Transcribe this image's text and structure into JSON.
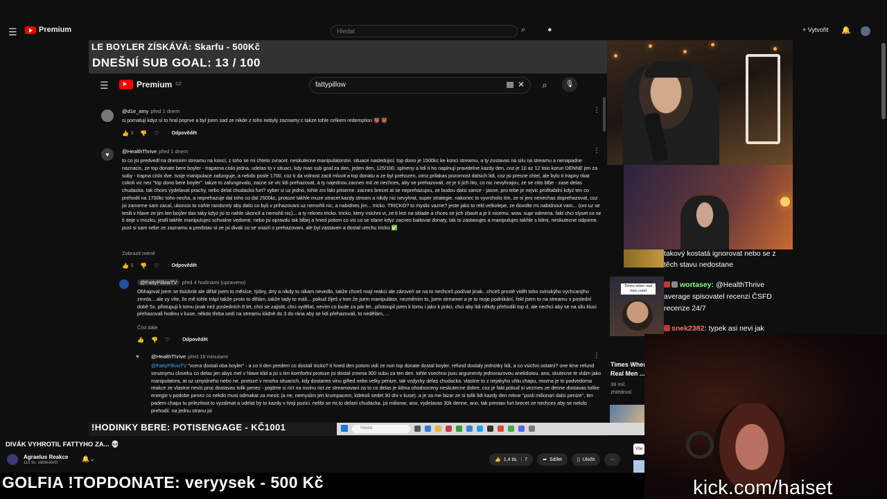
{
  "outer": {
    "menu_icon": "☰",
    "logo_text": "Premium",
    "search_placeholder": "Hledat",
    "create_label": "+ Vytvořit"
  },
  "overlay": {
    "line1": "LE BOYLER ZÍSKÁVÁ: Skarfu - 500Kč",
    "line2": "DNEŠNÍ SUB GOAL: 13 / 100",
    "bottom": "!HODINKY BERE: POTISENGAGE - KČ1001"
  },
  "inner": {
    "logo_text": "Premium",
    "logo_sup": "CZ",
    "search_value": "fattypillow"
  },
  "comments": [
    {
      "author": "@d1e_amy",
      "when": "před 1 dnem",
      "text": "si pomatuji kdyz si to hral poprve a byl jsem sad ze nikde z toho nebyly zaznamy:c takze tohle celkem redemption 👹 👹",
      "likes": "3",
      "reply": "Odpovědět"
    },
    {
      "author": "@HealthThrive",
      "when": "před 1 dnem",
      "text": "to co jsi predvedl na dnesnim streamu na konci, z toho se mi chtelo zvracet. neskutecne manipulatorstvi. situace nasledujici: top dono je 1500kc ke konci streamu, a ty zustavas na silu na streamu a nenapadne naznacis, ze top donate bere boyler - traparna cislo jedna. udelas to v situaci, kdy mas sub goal za den, jeden den, 125/100, splneny a lidi ti ho naplnuji pravidelne kazdy den, coz je 10 az 12 tisic korun DENNE jen za suby - trapna cislo dve. tvoje manipulace zafunguje, a nekdo posle 1700, coz ti da volnost zacit mluvit a top donatu a ze byl prehozen, cimz prilakas pozornost dalsich lidi, coz jsi presne chtel, ale bylo ti trapny rikat cokoli vic nez \"top dono bere boyler\". takze to zafungovalo, zacne se vic lidi prehazovat, a ty najednou zacnes mit ze nechces, aby se prehazovali, ze je ti jich lito, co nic nevyhrajou, ze se citis blbe - zase delas chudacka. tak chces vydelavat prachy, nebo delat chudacka furt? vyber si uz jedno, tohle zni fakt priserne. zacnes brecet at se neprehazujou, ze budou dalsi sance - jasne, pro tebe je nejvic profitabilni kdyz ten co prehodil na 1700kc toho necha, a neprehazuje dal toho co dal 2500kc, protoze takhle muze utracet kazdy stream a nikdy nic nevyhrat, super strategie. nakonec to vyvrcholis tim, ze si jeni nenechas doprehazovat, coz jsi zamerne sam zacal, ukoncis to nahle randomly aby dalsi co byli v prihazovani uz nemohli nic, a nabidnes jim... tricko. TRICKO? to myslis vazne? jeste jaks to rekl velkolepe, ze dovolte mi nabidnout vam... (oni uz se tesili v hlave ze jim ten boyler das taky kdyz jsi to nahle ukoncil a nemohli nic)... a ty reknes tricko. tricko, ktery vsichni vi, ze ti lezi na sklade a chces se jich zbavit a je k nicemu. wow. supr odmena. fakt chci slyset co se ti deje v mozku, jestli takhle manipulujes schvalne vedome, nebo jsi opravdu tak blbej a hned potom co vis co se stane kdyz zacnes baitovat donaty, tak to zastavujes a manipulujes takhle s lidmi, neskutecne odporne. pust si sam sebe ze zaznamu a predstav si ze jsi divak co se snazil o prehazovani, ale byl zastaven a dostal utechu tricko ✅",
      "more": "Zobrazit méně",
      "likes": "5",
      "reply": "Odpovědět"
    },
    {
      "author": "@FattyPillowTV",
      "when": "před 4 hodinami (upraveno)",
      "text": "Obhajoval jsem se tisíckrát ale dělal jsem to měsíce, týdny, dny a nikdy to nikam nevedlo, takže chceš moji reakci ale zároveň se na to nechceš podívat jinak...chceš prostě vidět toho svinskýho vychcanýho zmrda....ale vy víte, že mě tohle trápí takže proto to dělám..takže tady to máš... pokud žiješ v tom že jsem manipulátor, nezměním to, jsem streamer a je to moje podnikání, řekl jsem to na streamu v poslední době 5x, přistupuji k tomu jinak než posledních 8 let, chci se zajistit, chci vydělat, nevím co bude za pár let...přistoupil jsem k tomu i jako k práci, chci aby lidi někdy přehodili top d, ale nechci aby se na silu kluci přehazovali hodinu v kuse, někdo třeba sedí na streamu klidně do 3 do rána aby se lidi přehazovali, to nedělám, ...",
      "more": "Číst dále",
      "reply": "Odpovědět"
    },
    {
      "author": "@HealthThrive",
      "when": "před 19 minutami",
      "mention": "@FattyPillowTV",
      "text": "\"vcera dostali oba boyler\" - a co ti den predem co dostali tricko? ti hned den potom vidi ze non top donate dostal boyler. refund dostaly jednotky lidi, a co vsichni ostatni? one time refund smutnymu cloveku co delas jen abys mel v hlave klid a jsi s tim komfortni protoze jsi dostal zrovna 300 subu za ten den. tohle vsechno jsou argumenty jednorazovou anekdotou. ano, skutecne te vidim jako manipulatora, at uz umyslneho nebo ne. protoze v mnoha situacich, kdy dostanes vinu gifted nebo velky penize, tak vzdycky delas chudacka. vlastne to z nejakyho uhlu chapu, mozna je to podvedoma reakce ze vlastne nevis proc dostavas tolik penez - pojdme si rict na rovinu rict ze streamovani za to co delas je lidma ohodnoceny neskutecne dobre, coz je fakt pokud si vezmes ze denne dostavas tolike energie v podobe penez co nekdo musi odmakat za mesic (a ne, nemyslim jen krumpacem, kdekoli sedet 30 dni v kuse). a je za me bizar ze si tolik lidi kazdy den rekne \"posli milionari dalsi penize\", tim padem chapu tu prilezitost to vyzdimat a udelat by to kazdy v tvoji pozici. nelibi se mi to delani chudacka. jsi milionar, ano, vydelavas 30k denne, ano, tak prestan furt brecet ze nechces aby se nekdo prehodil. na jednu stranu jsi"
    }
  ],
  "side": {
    "chat": [
      {
        "user": "",
        "text": "takový kostatá ignorovat nebo se z"
      },
      {
        "user": "",
        "text": "těch stavu nedostane"
      },
      {
        "user": "wortasey:",
        "text": "@HealthThrive average spisovatel recenzi ČSFD recenze 24/7"
      },
      {
        "user": "snek2382:",
        "text": "typek asi nevi jak"
      }
    ],
    "thumb_tag": "Times when real men cried",
    "video_title_line1": "Times When",
    "video_title_line2": "Real Men ...",
    "video_views": "39 mil.",
    "video_views_label": "zhlédnutí"
  },
  "lower": {
    "video_title": "DIVÁK VYHROTIL FATTYHO ZA... 💀",
    "channel_name": "Agraelus Reakce",
    "channel_subs": "115 tis. odběratelů",
    "likes": "1,4 tis.",
    "comments_count": "7",
    "share_label": "Sdílet",
    "save_label": "Uložit",
    "join_label": "Vše"
  },
  "banner": {
    "text": "GOLFIA !TOPDONATE: veryysek - 500 Kč",
    "kick": "kick.com/haiset"
  },
  "colors": {
    "yt_red": "#ff0000",
    "background": "#0f0f0f",
    "chat_user_green": "#7dff7d",
    "chat_user_red": "#ff7070"
  }
}
